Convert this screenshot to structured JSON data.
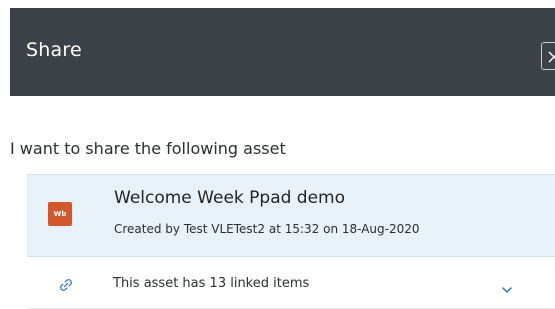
{
  "dialog": {
    "title": "Share",
    "close_icon": "close-icon"
  },
  "subtitle": "I want to share the following asset",
  "asset": {
    "badge": "Wb",
    "badge_color": "#d2582b",
    "title": "Welcome Week Ppad demo",
    "meta": "Created by Test VLETest2 at 15:32 on 18-Aug-2020"
  },
  "linked": {
    "icon": "link-icon",
    "text": "This asset has 13 linked items",
    "expand_icon": "chevron-down-icon"
  },
  "colors": {
    "header_bg": "#3d4148",
    "card_bg": "#e9f2f8",
    "accent": "#1a73c6"
  }
}
